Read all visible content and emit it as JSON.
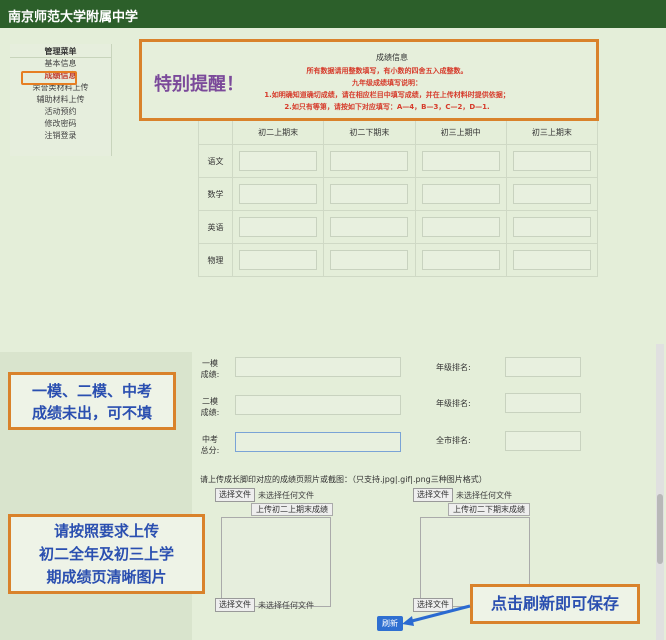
{
  "header": {
    "title": "南京师范大学附属中学"
  },
  "sidebar": {
    "title": "管理菜单",
    "items": [
      {
        "label": "基本信息"
      },
      {
        "label": "成绩信息"
      },
      {
        "label": "荣誉类材料上传"
      },
      {
        "label": "辅助材料上传"
      },
      {
        "label": "活动预约"
      },
      {
        "label": "修改密码"
      },
      {
        "label": "注销登录"
      }
    ]
  },
  "notice": {
    "heading": "成绩信息",
    "reminder": "特别提醒！",
    "lines": [
      "所有数据请用整数填写，有小数的四舍五入成整数。",
      "九年级成绩填写说明：",
      "1.如明确知道确切成绩，请在相应栏目中填写成绩，并在上传材料时提供依据；",
      "2.如只有等第，请按如下对应填写：A—4，B—3，C—2，D—1."
    ]
  },
  "score_table": {
    "columns": [
      "初二上期末",
      "初二下期末",
      "初三上期中",
      "初三上期末"
    ],
    "subjects": [
      "语文",
      "数学",
      "英语",
      "物理"
    ]
  },
  "exams": {
    "mock1": "一模\n成绩:",
    "mock2": "二模\n成绩:",
    "zhongkao": "中考\n总分:",
    "grade_rank": "年级排名:",
    "city_rank": "全市排名:"
  },
  "upload": {
    "title": "请上传成长脚印对应的成绩页照片或截图：（只支持.jpg|.gif|.png三种图片格式）",
    "choose_file": "选择文件",
    "no_file": "未选择任何文件",
    "first_term": "上传初二上期末成绩",
    "second_term": "上传初二下期末成绩"
  },
  "refresh_label": "刷新",
  "callouts": {
    "mock_note": "一模、二模、中考\n成绩未出，可不填",
    "upload_note": "请按照要求上传\n初二全年及初三上学\n期成绩页清晰图片",
    "save_note": "点击刷新即可保存"
  }
}
